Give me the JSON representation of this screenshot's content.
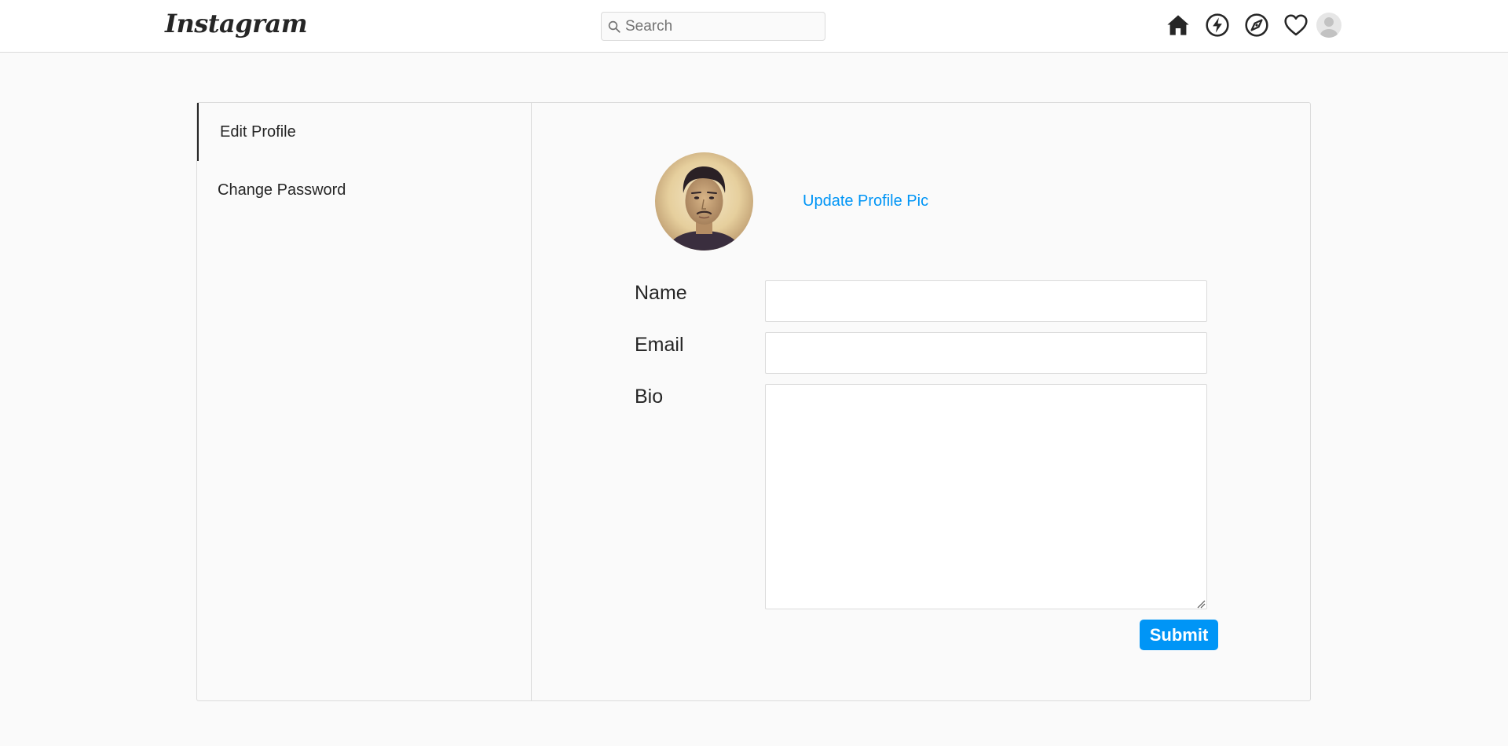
{
  "header": {
    "logo_text": "Instagram",
    "search": {
      "placeholder": "Search",
      "value": ""
    },
    "icons": [
      "home-icon",
      "activity-icon",
      "explore-icon",
      "heart-icon",
      "avatar-icon"
    ]
  },
  "sidebar": {
    "items": [
      {
        "label": "Edit Profile",
        "active": true
      },
      {
        "label": "Change Password",
        "active": false
      }
    ]
  },
  "edit_profile": {
    "update_pic_label": "Update Profile Pic",
    "fields": {
      "name": {
        "label": "Name",
        "value": ""
      },
      "email": {
        "label": "Email",
        "value": ""
      },
      "bio": {
        "label": "Bio",
        "value": ""
      }
    },
    "submit_label": "Submit"
  },
  "colors": {
    "accent": "#0095f6",
    "text": "#262626",
    "border": "#dbdbdb",
    "background": "#fafafa"
  }
}
